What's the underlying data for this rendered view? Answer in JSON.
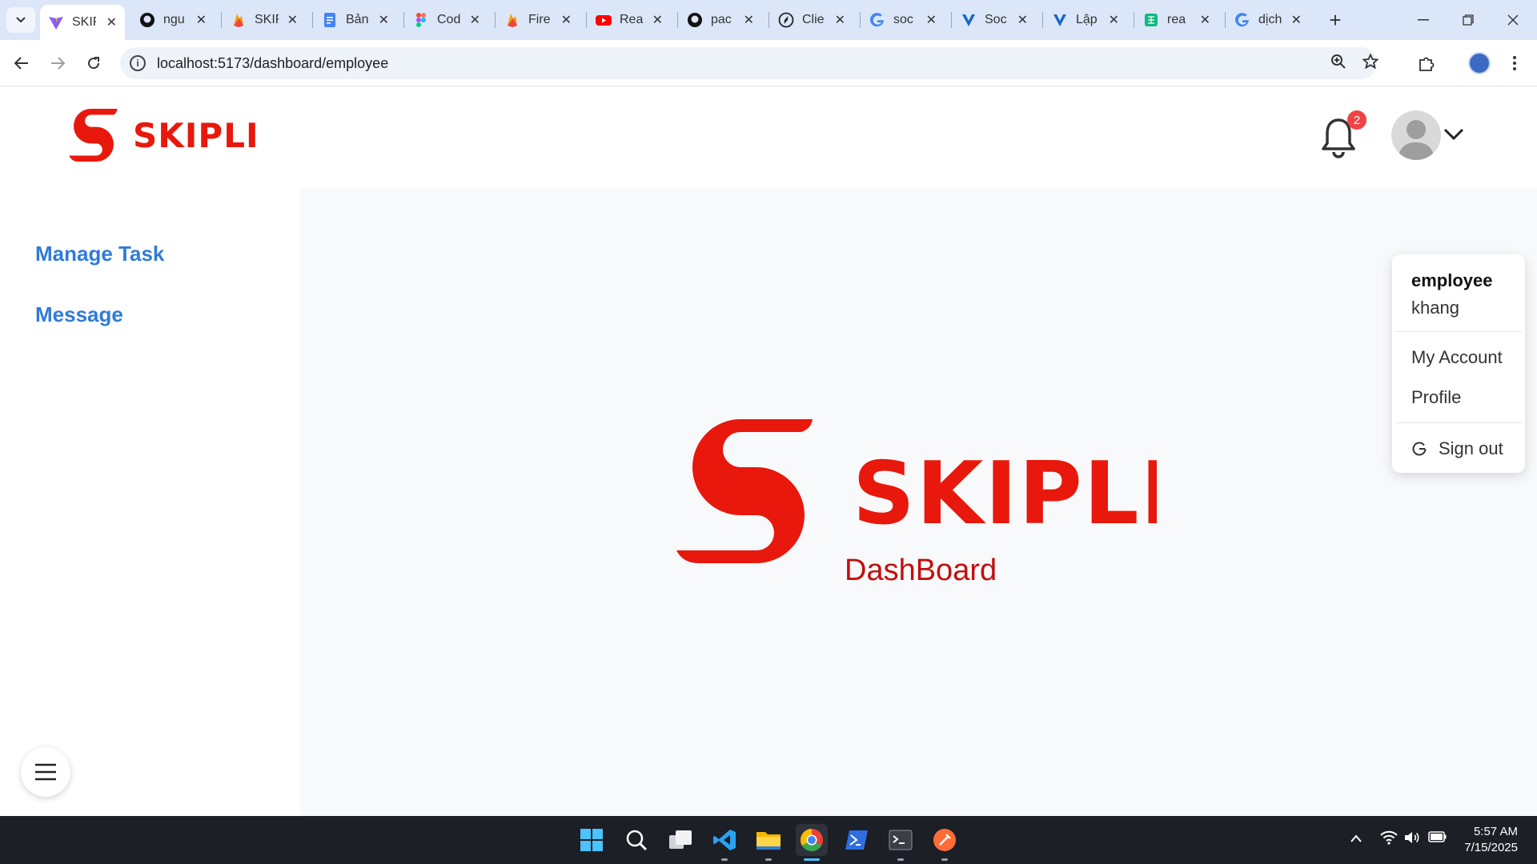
{
  "browser": {
    "tabs": [
      {
        "label": "SKIP",
        "icon": "vite-icon",
        "active": true
      },
      {
        "label": "ngu",
        "icon": "github-icon"
      },
      {
        "label": "SKIP",
        "icon": "firebase-icon"
      },
      {
        "label": "Bản",
        "icon": "docs-icon"
      },
      {
        "label": "Cod",
        "icon": "figma-icon"
      },
      {
        "label": "Fire",
        "icon": "firebase-icon"
      },
      {
        "label": "Rea",
        "icon": "youtube-icon"
      },
      {
        "label": "pac",
        "icon": "github-icon"
      },
      {
        "label": "Clie",
        "icon": "compass-icon"
      },
      {
        "label": "soc",
        "icon": "google-icon"
      },
      {
        "label": "Soc",
        "icon": "vuetify-icon"
      },
      {
        "label": "Lập",
        "icon": "vuetify-icon"
      },
      {
        "label": "rea",
        "icon": "sheets-icon"
      },
      {
        "label": "dịch",
        "icon": "google-icon"
      }
    ],
    "url": "localhost:5173/dashboard/employee"
  },
  "header": {
    "brand": "SKIPLI",
    "notification_count": "2"
  },
  "sidebar": {
    "items": [
      {
        "label": "Manage Task"
      },
      {
        "label": "Message"
      }
    ]
  },
  "main": {
    "hero_brand": "SKIPLI",
    "subtitle": "DashBoard"
  },
  "user_menu": {
    "role": "employee",
    "username": "khang",
    "items": [
      {
        "label": "My Account"
      },
      {
        "label": "Profile"
      }
    ],
    "sign_out": "Sign out"
  },
  "taskbar": {
    "time": "5:57 AM",
    "date": "7/15/2025"
  },
  "colors": {
    "brand_red": "#e8180c",
    "link_blue": "#2f7bd9",
    "badge_red": "#ef4444"
  }
}
